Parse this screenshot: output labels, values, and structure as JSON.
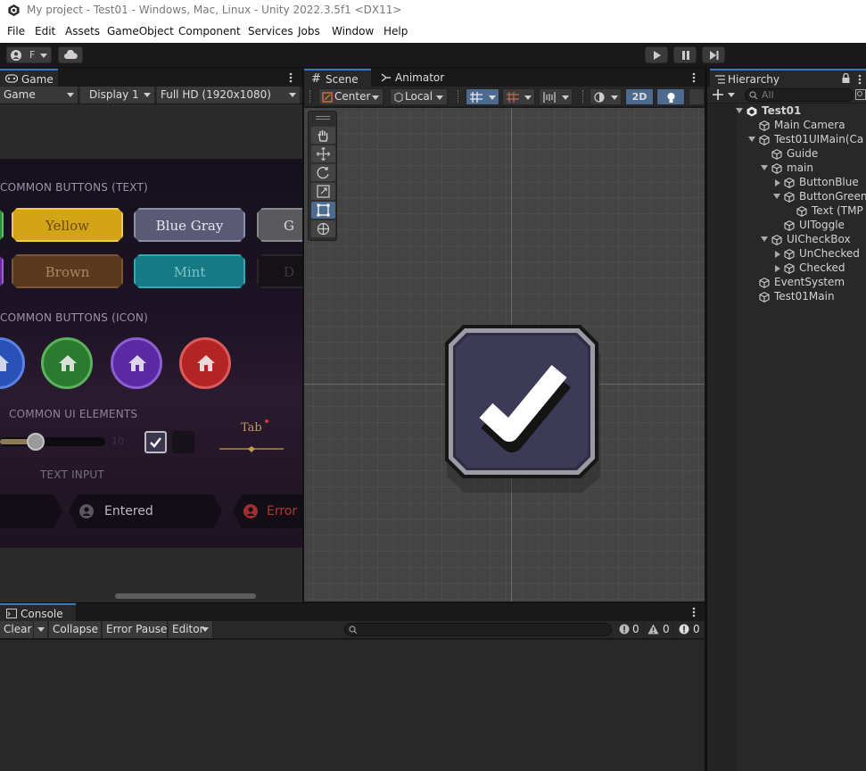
{
  "window": {
    "title": "My project - Test01 - Windows, Mac, Linux - Unity 2022.3.5f1 <DX11>"
  },
  "menu": [
    "File",
    "Edit",
    "Assets",
    "GameObject",
    "Component",
    "Services",
    "Jobs",
    "Window",
    "Help"
  ],
  "toolbar": {
    "account_label": "F"
  },
  "game": {
    "tab": "Game",
    "mode": "Game",
    "display": "Display 1",
    "resolution": "Full HD (1920x1080)",
    "sections": {
      "text_buttons": "COMMON BUTTONS (TEXT)",
      "icon_buttons": "COMMON BUTTONS (ICON)",
      "ui_elements": "COMMON UI ELEMENTS",
      "text_input": "TEXT INPUT"
    },
    "buttons_row1": [
      "Yellow",
      "Blue Gray",
      "G"
    ],
    "buttons_row2": [
      "Brown",
      "Mint",
      "D"
    ],
    "slider_max": "10",
    "tab_label": "Tab",
    "input_entered": "Entered",
    "input_error": "Error"
  },
  "scene": {
    "tabs": [
      "Scene",
      "Animator"
    ],
    "pivot": "Center",
    "space": "Local",
    "mode_2d": "2D"
  },
  "hierarchy": {
    "tab": "Hierarchy",
    "search_placeholder": "All",
    "items": [
      {
        "label": "Test01",
        "level": 0,
        "expand": "down",
        "root": true
      },
      {
        "label": "Main Camera",
        "level": 1,
        "expand": ""
      },
      {
        "label": "Test01UIMain(Ca",
        "level": 1,
        "expand": "down"
      },
      {
        "label": "Guide",
        "level": 2,
        "expand": ""
      },
      {
        "label": "main",
        "level": 2,
        "expand": "down"
      },
      {
        "label": "ButtonBlue",
        "level": 3,
        "expand": "right"
      },
      {
        "label": "ButtonGreen",
        "level": 3,
        "expand": "down"
      },
      {
        "label": "Text (TMP",
        "level": 4,
        "expand": ""
      },
      {
        "label": "UIToggle",
        "level": 3,
        "expand": ""
      },
      {
        "label": "UICheckBox",
        "level": 2,
        "expand": "down"
      },
      {
        "label": "UnChecked",
        "level": 3,
        "expand": "right"
      },
      {
        "label": "Checked",
        "level": 3,
        "expand": "right"
      },
      {
        "label": "EventSystem",
        "level": 1,
        "expand": ""
      },
      {
        "label": "Test01Main",
        "level": 1,
        "expand": ""
      }
    ]
  },
  "console": {
    "tab": "Console",
    "clear": "Clear",
    "collapse": "Collapse",
    "error_pause": "Error Pause",
    "editor": "Editor",
    "info_count": "0",
    "warn_count": "0",
    "error_count": "0"
  }
}
